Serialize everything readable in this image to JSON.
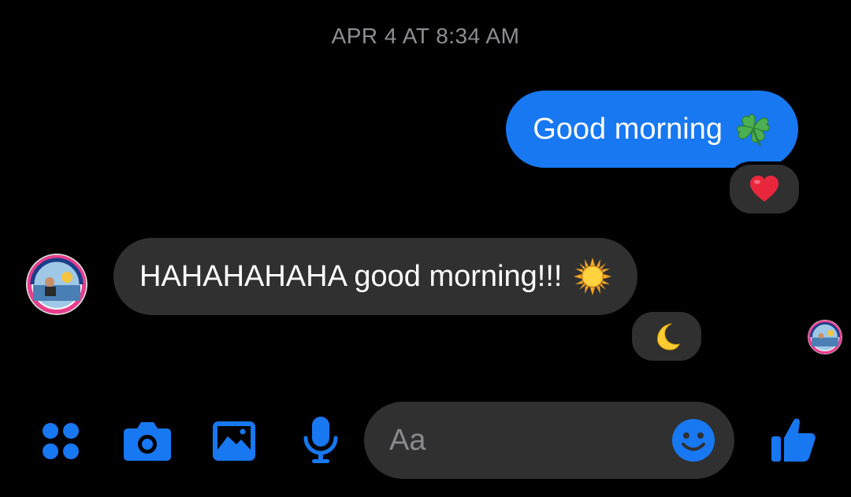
{
  "conversation": {
    "timestamp": "APR 4 AT 8:34 AM",
    "messages": [
      {
        "direction": "outgoing",
        "text": "Good morning",
        "emoji": "four-leaf-clover",
        "reaction": "heart"
      },
      {
        "direction": "incoming",
        "text": "HAHAHAHAHA good morning!!!",
        "emoji": "sun",
        "reaction": "crescent-moon"
      }
    ],
    "seen_indicator": "avatar"
  },
  "composer": {
    "placeholder": "Aa"
  },
  "toolbar": {
    "items": [
      "menu-icon",
      "camera-icon",
      "image-icon",
      "microphone-icon",
      "emoji-icon",
      "thumbs-up-icon"
    ]
  },
  "colors": {
    "accent": "#1778f2",
    "outgoing_bubble": "#1778f2",
    "incoming_bubble": "#303030",
    "background": "#000000",
    "timestamp": "#8e8e93",
    "placeholder": "#8a8a8e"
  }
}
